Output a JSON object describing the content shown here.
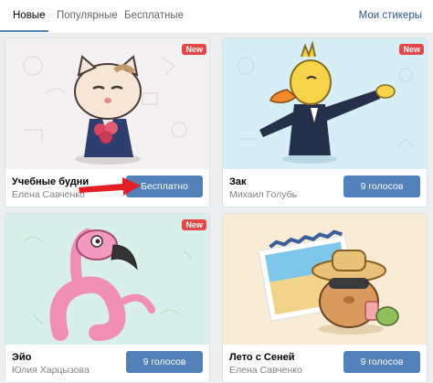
{
  "tabs": [
    {
      "label": "Новые"
    },
    {
      "label": "Популярные"
    },
    {
      "label": "Бесплатные"
    }
  ],
  "my_stickers": "Мои стикеры",
  "badge_label": "New",
  "cards": [
    {
      "name": "Учебные будни",
      "author": "Елена Савченко",
      "button": "Бесплатно",
      "is_new": true,
      "icon": "cat-in-jacket-sticker"
    },
    {
      "name": "Зак",
      "author": "Михаил Голубь",
      "button": "9 голосов",
      "is_new": true,
      "icon": "duck-in-suit-sticker"
    },
    {
      "name": "Эйо",
      "author": "Юлия Харцызова",
      "button": "9 голосов",
      "is_new": true,
      "icon": "pink-flamingo-sticker"
    },
    {
      "name": "Лето с Сеней",
      "author": "Елена Савченко",
      "button": "9 голосов",
      "is_new": false,
      "icon": "hamster-on-beach-sticker"
    }
  ],
  "colors": {
    "accent": "#5181b8",
    "new_badge": "#e64646",
    "arrow": "#e31e24"
  }
}
